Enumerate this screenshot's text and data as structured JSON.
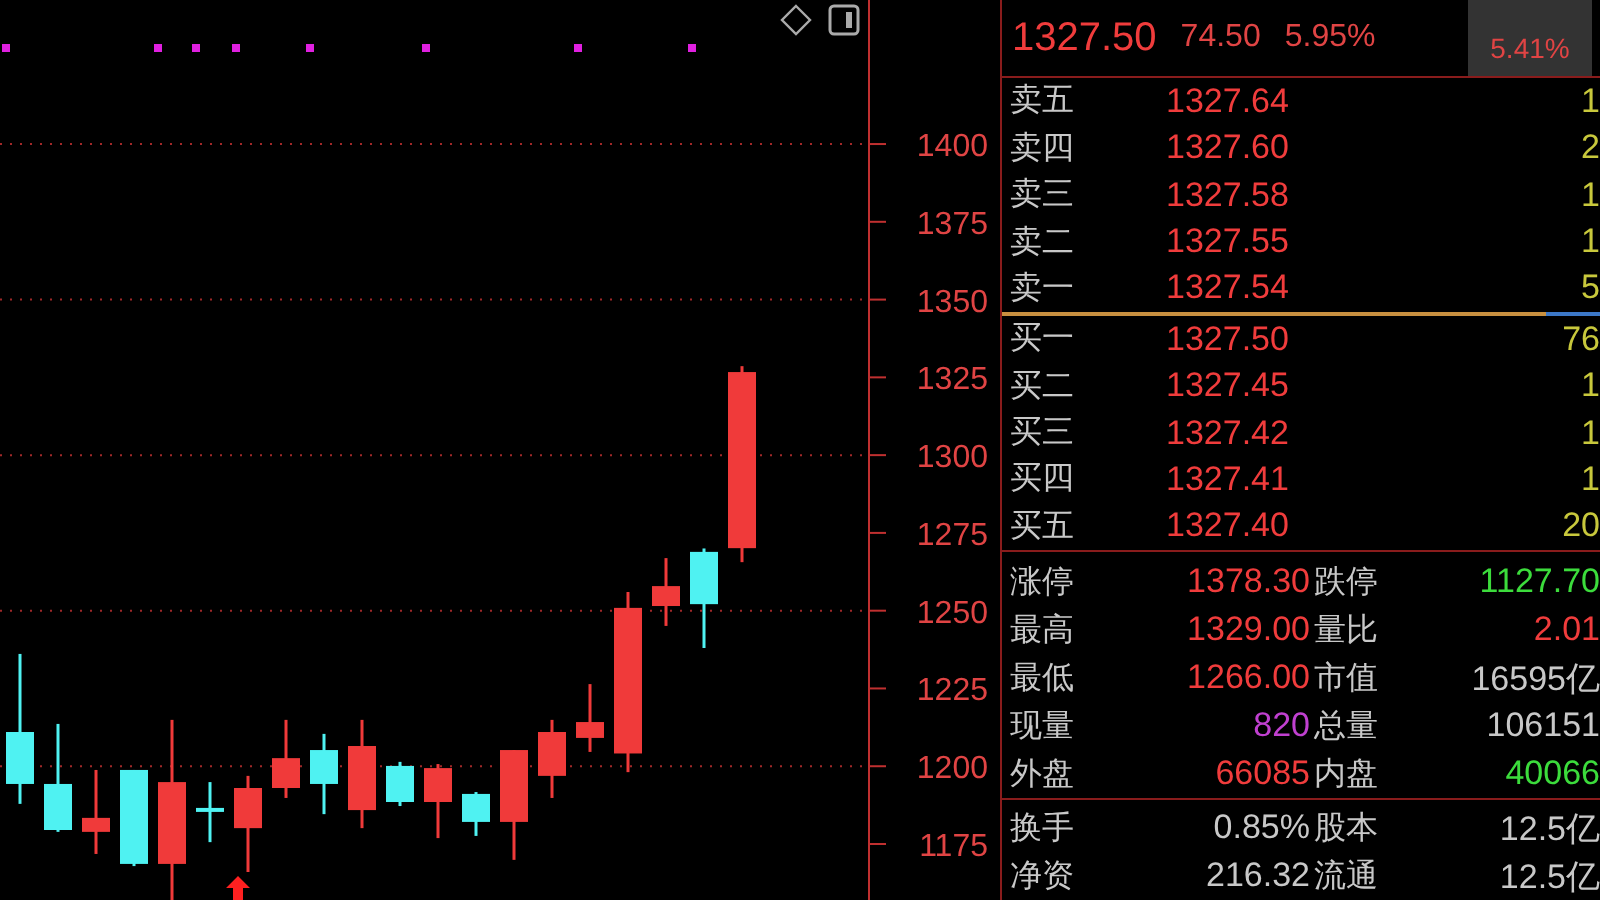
{
  "chart_data": {
    "type": "candlestick",
    "categories": [
      null,
      null,
      null,
      null,
      null,
      null,
      null,
      null,
      null,
      null,
      null,
      null,
      null,
      null,
      null,
      null,
      null,
      null,
      null,
      null
    ],
    "ohlc": [
      [
        1211.0,
        1236.1,
        1187.9,
        1194.3
      ],
      [
        1194.3,
        1213.6,
        1178.9,
        1179.5
      ],
      [
        1178.9,
        1198.8,
        1171.8,
        1183.4
      ],
      [
        1198.8,
        1198.8,
        1167.9,
        1168.6
      ],
      [
        1168.6,
        1214.9,
        1157.0,
        1194.9
      ],
      [
        1186.6,
        1194.9,
        1175.6,
        1185.9
      ],
      [
        1180.1,
        1196.9,
        1166.0,
        1193.0
      ],
      [
        1193.0,
        1214.9,
        1189.8,
        1202.6
      ],
      [
        1205.2,
        1210.4,
        1184.6,
        1194.3
      ],
      [
        1185.9,
        1214.9,
        1180.1,
        1206.5
      ],
      [
        1200.1,
        1201.4,
        1187.2,
        1188.5
      ],
      [
        1188.5,
        1200.7,
        1176.9,
        1199.4
      ],
      [
        1191.1,
        1191.7,
        1177.6,
        1182.1
      ],
      [
        1182.1,
        1205.2,
        1169.9,
        1205.2
      ],
      [
        1196.9,
        1214.9,
        1189.8,
        1211.0
      ],
      [
        1209.1,
        1226.4,
        1204.6,
        1214.2
      ],
      [
        1204.1,
        1256.0,
        1198.1,
        1250.9
      ],
      [
        1251.5,
        1266.9,
        1245.1,
        1257.9
      ],
      [
        1268.9,
        1270.0,
        1238.0,
        1252.1
      ],
      [
        1270.1,
        1328.6,
        1265.6,
        1326.7
      ]
    ],
    "ylim": [
      1157.0,
      1446.3
    ],
    "grid": true,
    "yticks": [
      {
        "value": 1400,
        "label": "1400"
      },
      {
        "value": 1375,
        "label": "1375"
      },
      {
        "value": 1350,
        "label": "1350"
      },
      {
        "value": 1325,
        "label": "1325"
      },
      {
        "value": 1300,
        "label": "1300"
      },
      {
        "value": 1275,
        "label": "1275"
      },
      {
        "value": 1250,
        "label": "1250"
      },
      {
        "value": 1225,
        "label": "1225"
      },
      {
        "value": 1200,
        "label": "1200"
      },
      {
        "value": 1175,
        "label": "1175"
      }
    ]
  },
  "quote": {
    "price": "1327.50",
    "change": "74.50",
    "percent": "5.95%",
    "badge": "5.41%"
  },
  "asks": [
    {
      "label": "卖五",
      "price": "1327.64",
      "volume": "1"
    },
    {
      "label": "卖四",
      "price": "1327.60",
      "volume": "2"
    },
    {
      "label": "卖三",
      "price": "1327.58",
      "volume": "1"
    },
    {
      "label": "卖二",
      "price": "1327.55",
      "volume": "1"
    },
    {
      "label": "卖一",
      "price": "1327.54",
      "volume": "5"
    }
  ],
  "ratio_bar": {
    "level": 0.91
  },
  "bids": [
    {
      "label": "买一",
      "price": "1327.50",
      "volume": "76"
    },
    {
      "label": "买二",
      "price": "1327.45",
      "volume": "1"
    },
    {
      "label": "买三",
      "price": "1327.42",
      "volume": "1"
    },
    {
      "label": "买四",
      "price": "1327.41",
      "volume": "1"
    },
    {
      "label": "买五",
      "price": "1327.40",
      "volume": "20"
    }
  ],
  "stats": [
    [
      {
        "label": "涨停",
        "value": "1378.30",
        "color": "#f03c3c"
      },
      {
        "label": "跌停",
        "value": "1127.70",
        "color": "#3cdc3c"
      }
    ],
    [
      {
        "label": "最高",
        "value": "1329.00",
        "color": "#f03c3c"
      },
      {
        "label": "量比",
        "value": "2.01",
        "color": "#f03c3c"
      }
    ],
    [
      {
        "label": "最低",
        "value": "1266.00",
        "color": "#f03c3c"
      },
      {
        "label": "市值",
        "value": "16595亿",
        "color": "#c8c8c8"
      }
    ],
    [
      {
        "label": "现量",
        "value": "820",
        "color": "#c040d0"
      },
      {
        "label": "总量",
        "value": "106151",
        "color": "#c8c8c8"
      }
    ],
    [
      {
        "label": "外盘",
        "value": "66085",
        "color": "#f03c3c"
      },
      {
        "label": "内盘",
        "value": "40066",
        "color": "#3cdc3c"
      }
    ]
  ],
  "fundamentals": [
    [
      {
        "label": "换手",
        "value": "0.85%",
        "color": "#c8c8c8"
      },
      {
        "label": "股本",
        "value": "12.5亿",
        "color": "#c8c8c8"
      }
    ],
    [
      {
        "label": "净资",
        "value": "216.32",
        "color": "#c8c8c8"
      },
      {
        "label": "流通",
        "value": "12.5亿",
        "color": "#c8c8c8"
      }
    ]
  ]
}
